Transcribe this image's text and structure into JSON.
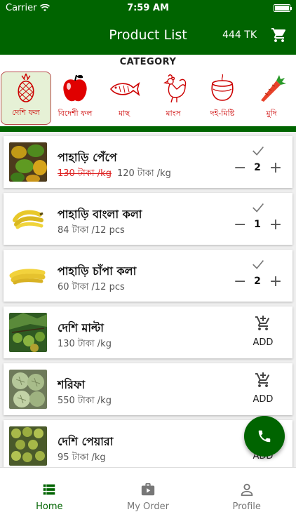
{
  "status": {
    "carrier": "Carrier",
    "time": "7:59 AM"
  },
  "appbar": {
    "title": "Product List",
    "balance": "444 TK"
  },
  "category_heading": "CATEGORY",
  "categories": [
    {
      "label": "দেশি ফল",
      "icon": "pineapple-icon",
      "selected": true
    },
    {
      "label": "বিদেশী ফল",
      "icon": "apple-icon"
    },
    {
      "label": "মাছ",
      "icon": "fish-icon"
    },
    {
      "label": "মাংস",
      "icon": "rooster-icon"
    },
    {
      "label": "দই-মিষ্টি",
      "icon": "sweets-pot-icon"
    },
    {
      "label": "মুদি",
      "icon": "grocery-icon"
    }
  ],
  "products": [
    {
      "name": "পাহাড়ি পেঁপে",
      "old_price": "130 টাকা /kg",
      "price": "120 টাকা /kg",
      "qty": "2",
      "state": "added"
    },
    {
      "name": "পাহাড়ি বাংলা কলা",
      "price": "84 টাকা /12 pcs",
      "qty": "1",
      "state": "added"
    },
    {
      "name": "পাহাড়ি চাঁপা কলা",
      "price": "60 টাকা /12 pcs",
      "qty": "2",
      "state": "added"
    },
    {
      "name": "দেশি মাল্টা",
      "price": "130 টাকা /kg",
      "add_label": "ADD",
      "state": "new"
    },
    {
      "name": "শরিফা",
      "price": "550 টাকা /kg",
      "add_label": "ADD",
      "state": "new"
    },
    {
      "name": "দেশি পেয়ারা",
      "price": "95 টাকা /kg",
      "add_label": "ADD",
      "state": "new"
    }
  ],
  "nav": [
    {
      "label": "Home",
      "icon": "home-list-icon",
      "active": true
    },
    {
      "label": "My Order",
      "icon": "briefcase-play-icon"
    },
    {
      "label": "Profile",
      "icon": "person-icon"
    }
  ],
  "colors": {
    "primary": "#006400",
    "discount": "#dd2222",
    "category_label": "#cc0000"
  }
}
